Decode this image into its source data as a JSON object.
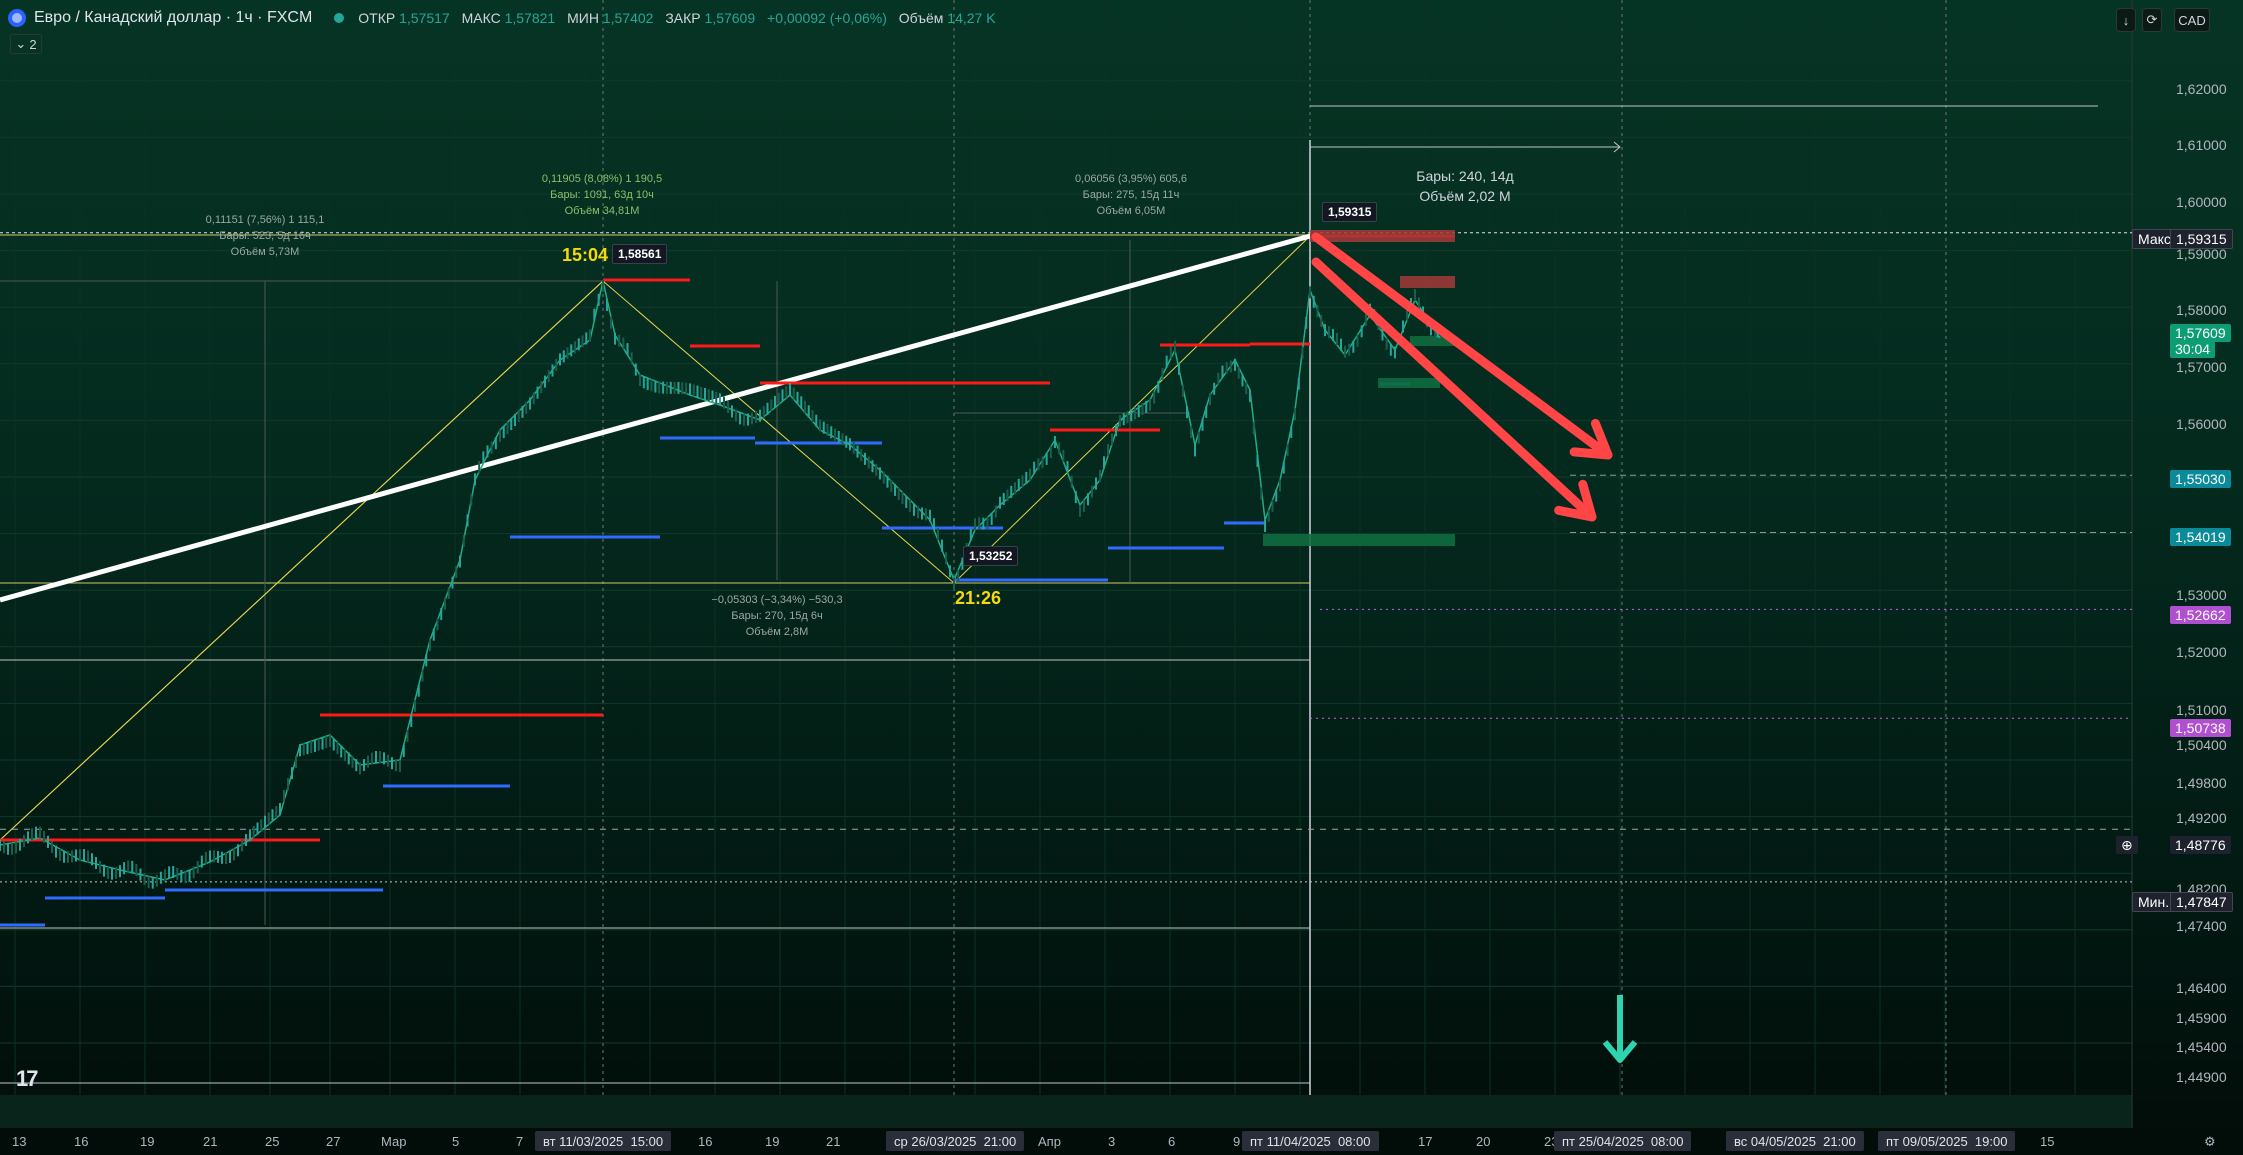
{
  "header": {
    "title": "Евро / Канадский доллар · 1ч · FXCM",
    "open_label": "ОТКР",
    "open": "1,57517",
    "high_label": "МАКС",
    "high": "1,57821",
    "low_label": "МИН",
    "low": "1,57402",
    "close_label": "ЗАКР",
    "close": "1,57609",
    "change": "+0,00092 (+0,06%)",
    "volume_label": "Объём",
    "volume": "14,27 K",
    "indicators_count": "2"
  },
  "toolbar": {
    "currency": "CAD",
    "download_icon": "download-icon",
    "reset_icon": "reset-icon"
  },
  "tv_logo": "17",
  "price_axis": {
    "labels": [
      "1,62000",
      "1,61000",
      "1,60000",
      "1,59000",
      "1,58000",
      "1,57000",
      "1,56000",
      "1,53000",
      "1,52000",
      "1,51000",
      "1,50400",
      "1,49800",
      "1,49200",
      "1,48200",
      "1,47400",
      "1,46400",
      "1,45900",
      "1,45400",
      "1,44900"
    ],
    "badges": {
      "max_label": "Макс.",
      "max": "1,59315",
      "current": "1,57609",
      "countdown": "30:04",
      "level1": "1,55030",
      "level2": "1,54019",
      "level3": "1,52662",
      "level4": "1,50738",
      "crosshair": "1,48776",
      "min_label": "Мин.",
      "min": "1,47847"
    }
  },
  "time_axis": {
    "labels": [
      "13",
      "16",
      "19",
      "21",
      "25",
      "27",
      "Мар",
      "5",
      "7",
      "16",
      "19",
      "21",
      "Апр",
      "3",
      "6",
      "9",
      "17",
      "20",
      "23",
      "15"
    ],
    "badges": [
      "вт 11/03/2025",
      "15:00",
      "ср 26/03/2025",
      "21:00",
      "пт 11/04/2025",
      "08:00",
      "пт 25/04/2025",
      "08:00",
      "вс 04/05/2025",
      "21:00",
      "пт 09/05/2025",
      "19:00"
    ]
  },
  "annotations": {
    "measure1": [
      "0,11151 (7,56%) 1 115,1",
      "Бары: 523, 5д 16ч",
      "Объём 5,73M"
    ],
    "measure2": [
      "0,11905 (8,08%) 1 190,5",
      "Бары: 1091, 63д 10ч",
      "Объём 34,81M"
    ],
    "measure3": [
      "0,06056 (3,95%) 605,6",
      "Бары: 275, 15д 11ч",
      "Объём 6,05M"
    ],
    "measure4": [
      "−0,05303 (−3,34%) −530,3",
      "Бары: 270, 15д 6ч",
      "Объём 2,8M"
    ],
    "range": [
      "Бары: 240, 14д",
      "Объём 2,02 M"
    ],
    "time1": "15:04",
    "time2": "21:26",
    "peak1": "1,58561",
    "trough": "1,53252",
    "peak2": "1,59315"
  },
  "chart_data": {
    "type": "line",
    "title": "Евро / Канадский доллар · 1ч · FXCM",
    "xlabel": "",
    "ylabel": "",
    "ylim": [
      1.449,
      1.625
    ],
    "series": [
      {
        "x": [
          "13",
          "19",
          "25",
          "Мар",
          "5",
          "7",
          "вт 11/03/2025 15:00",
          "16",
          "19",
          "21",
          "ср 26/03/2025 21:00",
          "Апр",
          "3",
          "6",
          "9",
          "пт 11/04/2025 08:00",
          "17"
        ],
        "values": [
          1.482,
          1.481,
          1.492,
          1.503,
          1.548,
          1.556,
          1.5856,
          1.57,
          1.566,
          1.56,
          1.5325,
          1.552,
          1.561,
          1.566,
          1.552,
          1.5931,
          1.5761
        ]
      }
    ],
    "levels": [
      1.59315,
      1.5503,
      1.54019,
      1.52662,
      1.50738,
      1.48776,
      1.47847
    ],
    "grid": true
  }
}
